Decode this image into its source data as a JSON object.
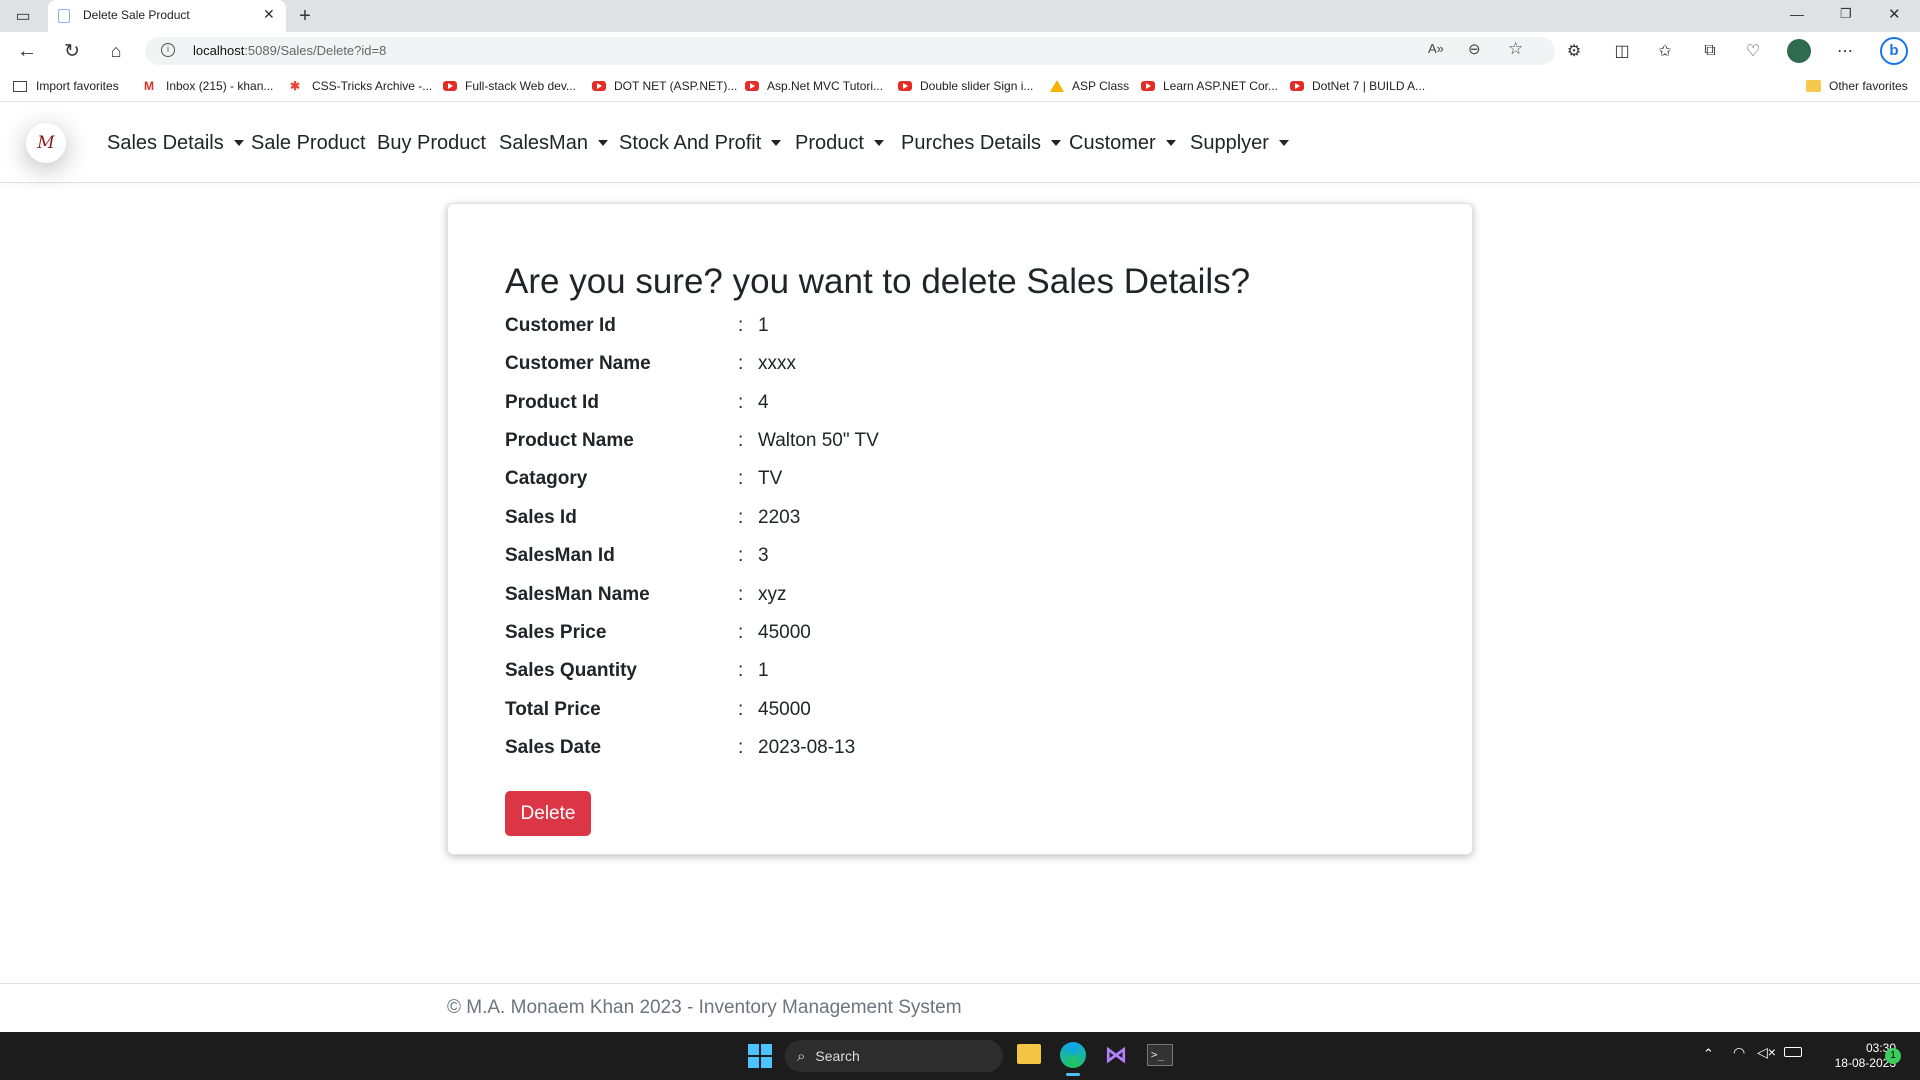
{
  "browser": {
    "tab_title": "Delete Sale Product",
    "url_host": "localhost",
    "url_rest": ":5089/Sales/Delete?id=8",
    "bookmarks": [
      {
        "label": "Import favorites",
        "icon": "import-icon"
      },
      {
        "label": "Inbox (215) - khan...",
        "icon": "gmail-icon"
      },
      {
        "label": "CSS-Tricks Archive -...",
        "icon": "css-tricks-icon"
      },
      {
        "label": "Full-stack Web dev...",
        "icon": "youtube-icon"
      },
      {
        "label": "DOT NET (ASP.NET)...",
        "icon": "youtube-icon"
      },
      {
        "label": "Asp.Net MVC Tutori...",
        "icon": "youtube-icon"
      },
      {
        "label": "Double slider Sign i...",
        "icon": "youtube-icon"
      },
      {
        "label": "ASP Class",
        "icon": "drive-icon"
      },
      {
        "label": "Learn ASP.NET Cor...",
        "icon": "youtube-icon"
      },
      {
        "label": "DotNet 7 | BUILD A...",
        "icon": "youtube-icon"
      }
    ],
    "other_favorites": "Other favorites"
  },
  "navbar": {
    "logo_text": "M",
    "items": [
      {
        "label": "Sales Details",
        "dropdown": true
      },
      {
        "label": "Sale Product",
        "dropdown": false
      },
      {
        "label": "Buy Product",
        "dropdown": false
      },
      {
        "label": "SalesMan",
        "dropdown": true
      },
      {
        "label": "Stock And Profit",
        "dropdown": true
      },
      {
        "label": "Product",
        "dropdown": true
      },
      {
        "label": "Purches Details",
        "dropdown": true
      },
      {
        "label": "Customer",
        "dropdown": true
      },
      {
        "label": "Supplyer",
        "dropdown": true
      }
    ]
  },
  "main": {
    "title": "Are you sure? you want to delete Sales Details?",
    "separator": ":",
    "fields": [
      {
        "label": "Customer Id",
        "value": "1"
      },
      {
        "label": "Customer Name",
        "value": "xxxx"
      },
      {
        "label": "Product Id",
        "value": "4"
      },
      {
        "label": "Product Name",
        "value": "Walton 50\" TV"
      },
      {
        "label": "Catagory",
        "value": "TV"
      },
      {
        "label": "Sales Id",
        "value": "2203"
      },
      {
        "label": "SalesMan Id",
        "value": "3"
      },
      {
        "label": "SalesMan Name",
        "value": "xyz"
      },
      {
        "label": "Sales Price",
        "value": "45000"
      },
      {
        "label": "Sales Quantity",
        "value": "1"
      },
      {
        "label": "Total Price",
        "value": "45000"
      },
      {
        "label": "Sales Date",
        "value": "2023-08-13"
      }
    ],
    "delete_label": "Delete",
    "delete_color": "#dc3545"
  },
  "footer": {
    "text": "© M.A. Monaem Khan 2023 - Inventory Management System"
  },
  "taskbar": {
    "search_label": "Search",
    "time": "03:30",
    "date": "18-08-2023",
    "notification_count": "1"
  }
}
